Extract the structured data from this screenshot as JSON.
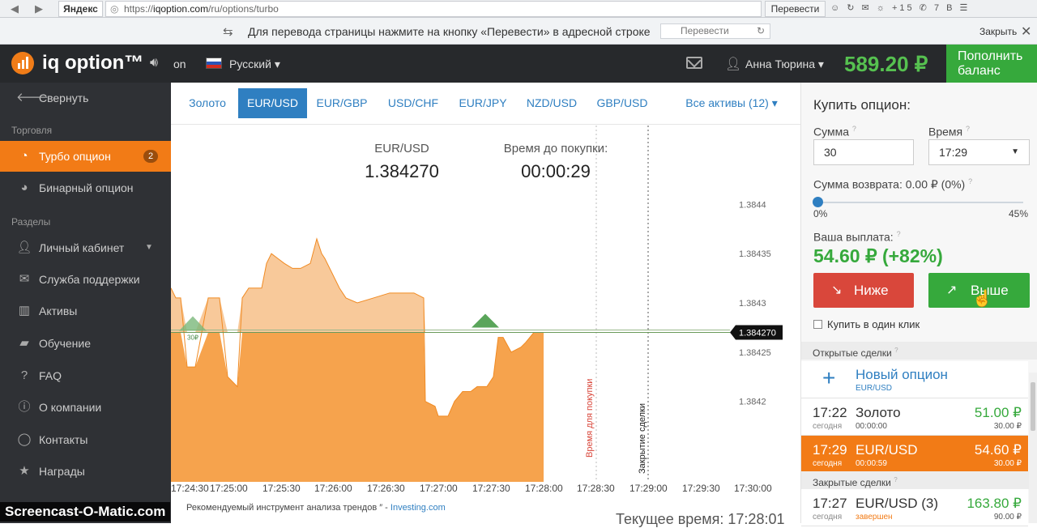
{
  "browser": {
    "yandex_label": "Яндекс",
    "url_prefix": "https://",
    "url_host": "iqoption.com",
    "url_path": "/ru/options/turbo",
    "translate_button": "Перевести",
    "icons_text": "☺ ↻ ✉ ☼ +15 ✆ 7 B ☰"
  },
  "translate_bar": {
    "text": "Для перевода страницы нажмите на кнопку «Перевести» в адресной строке",
    "button": "Перевести",
    "close_label": "Закрыть"
  },
  "header": {
    "logo_text": "iq option™",
    "sound_label": "on",
    "language": "Русский",
    "username": "Анна Тюрина",
    "balance": "589.20 ₽",
    "deposit_line1": "Пополнить",
    "deposit_line2": "баланс"
  },
  "sidebar": {
    "collapse": "Свернуть",
    "section_trading": "Торговля",
    "turbo": "Турбо опцион",
    "turbo_badge": "2",
    "binary": "Бинарный опцион",
    "section_parts": "Разделы",
    "cabinet": "Личный кабинет",
    "support": "Служба поддержки",
    "assets": "Активы",
    "learning": "Обучение",
    "faq": "FAQ",
    "about": "О компании",
    "contacts": "Контакты",
    "awards": "Награды"
  },
  "tabs": {
    "gold": "Золото",
    "eurusd": "EUR/USD",
    "eurgbp": "EUR/GBP",
    "usdchf": "USD/CHF",
    "eurjpy": "EUR/JPY",
    "nzdusd": "NZD/USD",
    "gbpusd": "GBP/USD",
    "all": "Все активы (12) ▾"
  },
  "chart_info": {
    "asset_label": "EUR/USD",
    "asset_value": "1.384270",
    "time_label": "Время до покупки:",
    "time_value": "00:00:29",
    "purchase_line_label": "Время для покупки",
    "close_line_label": "Закрытие сделки",
    "marker_label": "30₽"
  },
  "chart_data": {
    "type": "area",
    "ylim": [
      1.38412,
      1.38448
    ],
    "y_ticks": [
      "1.3844",
      "1.38435",
      "1.3843",
      "1.38425",
      "1.3842"
    ],
    "x_ticks": [
      "17:24:30",
      "17:25:00",
      "17:25:30",
      "17:26:00",
      "17:26:30",
      "17:27:00",
      "17:27:30",
      "17:28:00",
      "17:28:30",
      "17:29:00",
      "17:29:30",
      "17:30:00"
    ],
    "current_price": "1.384270",
    "current_price_value": 1.38427,
    "series": [
      {
        "values": [
          [
            0,
            1.384315
          ],
          [
            6,
            1.384305
          ],
          [
            12,
            1.384305
          ],
          [
            20,
            1.384235
          ],
          [
            30,
            1.384235
          ],
          [
            46,
            1.384305
          ],
          [
            60,
            1.384305
          ],
          [
            70,
            1.384225
          ],
          [
            82,
            1.384215
          ],
          [
            88,
            1.384305
          ],
          [
            96,
            1.384315
          ],
          [
            112,
            1.384315
          ],
          [
            118,
            1.38434
          ],
          [
            124,
            1.38435
          ],
          [
            132,
            1.384345
          ],
          [
            140,
            1.38434
          ],
          [
            150,
            1.384335
          ],
          [
            160,
            1.384335
          ],
          [
            172,
            1.38434
          ],
          [
            180,
            1.384365
          ],
          [
            186,
            1.38435
          ],
          [
            190,
            1.384345
          ],
          [
            208,
            1.384315
          ],
          [
            216,
            1.384305
          ],
          [
            230,
            1.3843
          ],
          [
            250,
            1.384305
          ],
          [
            270,
            1.38431
          ],
          [
            300,
            1.38431
          ],
          [
            312,
            1.384305
          ],
          [
            314,
            1.3842
          ],
          [
            326,
            1.384195
          ],
          [
            330,
            1.384185
          ],
          [
            342,
            1.384185
          ],
          [
            350,
            1.3842
          ],
          [
            360,
            1.38421
          ],
          [
            370,
            1.38421
          ],
          [
            378,
            1.384215
          ],
          [
            390,
            1.384215
          ],
          [
            398,
            1.384225
          ],
          [
            404,
            1.384265
          ],
          [
            410,
            1.384265
          ],
          [
            420,
            1.38425
          ],
          [
            432,
            1.384255
          ],
          [
            438,
            1.38426
          ],
          [
            448,
            1.38427
          ],
          [
            460,
            1.38427
          ]
        ]
      }
    ]
  },
  "xtime_labels": [
    "17:24:30",
    "17:25:00",
    "17:25:30",
    "17:26:00",
    "17:26:30",
    "17:27:00",
    "17:27:30",
    "17:28:00",
    "17:28:30",
    "17:29:00",
    "17:29:30",
    "17:30:00"
  ],
  "footer": {
    "note_text": "Рекомендуемый инструмент анализа трендов ″ - ",
    "note_link": "Investing.com",
    "current_time": "Текущее время: 17:28:01"
  },
  "panel": {
    "title": "Купить опцион:",
    "amount_label": "Сумма",
    "amount_value": "30",
    "time_label": "Время",
    "time_value": "17:29",
    "return_label": "Сумма возврата: 0.00 ₽ (0%)",
    "return_level": 0,
    "slider_min": "0%",
    "slider_max": "45%",
    "payout_label": "Ваша выплата:",
    "payout_value": "54.60 ₽ (+82%)",
    "down_button": "Ниже",
    "up_button": "Выше",
    "one_click": "Купить в один клик",
    "open_deals": "Открытые сделки",
    "new_option": "Новый опцион",
    "new_option_asset": "EUR/USD",
    "closed_deals": "Закрытые сделки"
  },
  "deals": [
    {
      "time": "17:22",
      "day": "сегодня",
      "asset": "Золото",
      "sub": "00:00:00",
      "payout": "51.00 ₽",
      "invest": "30.00 ₽"
    },
    {
      "time": "17:29",
      "day": "сегодня",
      "asset": "EUR/USD",
      "sub": "00:00:59",
      "payout": "54.60 ₽",
      "invest": "30.00 ₽"
    },
    {
      "time": "17:27",
      "day": "сегодня",
      "asset": "EUR/USD (3)",
      "sub": "завершен",
      "payout": "163.80 ₽",
      "invest": "90.00 ₽"
    }
  ],
  "watermark": "Screencast-O-Matic.com",
  "colors": {
    "accent": "#f27b16",
    "green": "#36a93c",
    "red": "#d9473b",
    "blue": "#2f7fc1"
  }
}
